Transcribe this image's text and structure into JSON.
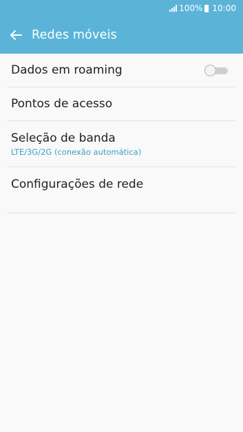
{
  "status_bar": {
    "battery": "100%",
    "time": "10:00"
  },
  "app_bar": {
    "title": "Redes móveis"
  },
  "settings": [
    {
      "label": "Dados em roaming",
      "toggle": false
    },
    {
      "label": "Pontos de acesso"
    },
    {
      "label": "Seleção de banda",
      "sub": "LTE/3G/2G (conexão automática)"
    },
    {
      "label": "Configurações de rede"
    }
  ],
  "colors": {
    "accent": "#5bb4d8",
    "subtext": "#3a9fca"
  }
}
